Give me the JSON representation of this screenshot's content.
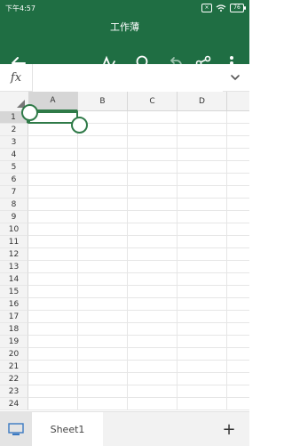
{
  "status": {
    "time": "下午4:57",
    "battery": "76"
  },
  "header": {
    "title": "工作薄"
  },
  "formula": {
    "label": "fx",
    "placeholder": ""
  },
  "columns": [
    "A",
    "B",
    "C",
    "D"
  ],
  "rows": [
    "1",
    "2",
    "3",
    "4",
    "5",
    "6",
    "7",
    "8",
    "9",
    "10",
    "11",
    "12",
    "13",
    "14",
    "15",
    "16",
    "17",
    "18",
    "19",
    "20",
    "21",
    "22",
    "23",
    "24"
  ],
  "selection": {
    "cell": "A1"
  },
  "sheets": {
    "tabs": [
      "Sheet1"
    ],
    "add": "+"
  },
  "colors": {
    "brand": "#1f6e43",
    "accent": "#2f7a48"
  }
}
